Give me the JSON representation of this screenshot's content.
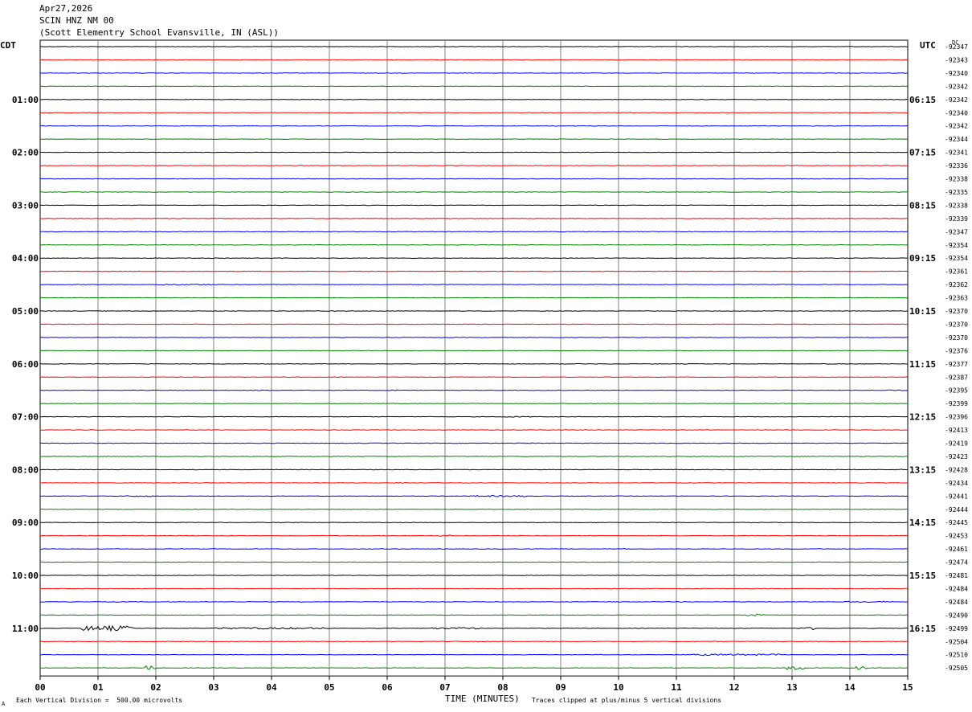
{
  "header": {
    "date": "Apr27,2026",
    "station": "SCIN HNZ NM 00",
    "location": "(Scott Elementry School Evansville, IN (ASL))"
  },
  "left_tz": "CDT",
  "right_tz": "UTC",
  "dc_label": "DC",
  "footer": {
    "scale_note": "Each Vertical Division =  500.00 microvolts",
    "x_title": "TIME (MINUTES)",
    "clip_note": "Traces clipped at plus/minus 5 vertical divisions",
    "corner_mark": "A"
  },
  "colors": {
    "trace_cycle": [
      "#000000",
      "#ff0000",
      "#0000ff",
      "#008000"
    ],
    "grid": "#808080"
  },
  "chart_data": {
    "type": "line",
    "title": "SCIN HNZ NM 00",
    "xlabel": "TIME (MINUTES)",
    "x_ticks": [
      "00",
      "01",
      "02",
      "03",
      "04",
      "05",
      "06",
      "07",
      "08",
      "09",
      "10",
      "11",
      "12",
      "13",
      "14",
      "15"
    ],
    "xlim": [
      0,
      15
    ],
    "minutes_per_line": 15,
    "left_time_labels": [
      "01:00",
      "02:00",
      "03:00",
      "04:00",
      "05:00",
      "06:00",
      "07:00",
      "08:00",
      "09:00",
      "10:00",
      "11:00"
    ],
    "right_time_labels": [
      "06:15",
      "07:15",
      "08:15",
      "09:15",
      "10:15",
      "11:15",
      "12:15",
      "13:15",
      "14:15",
      "15:15",
      "16:15"
    ],
    "dc_offsets": [
      "-92347",
      "-92343",
      "-92340",
      "-92342",
      "-92342",
      "-92340",
      "-92342",
      "-92344",
      "-92341",
      "-92336",
      "-92338",
      "-92335",
      "-92338",
      "-92339",
      "-92347",
      "-92354",
      "-92354",
      "-92361",
      "-92362",
      "-92363",
      "-92370",
      "-92370",
      "-92370",
      "-92376",
      "-92377",
      "-92387",
      "-92395",
      "-92399",
      "-92396",
      "-92413",
      "-92419",
      "-92423",
      "-92428",
      "-92434",
      "-92441",
      "-92444",
      "-92445",
      "-92453",
      "-92461",
      "-92474",
      "-92481",
      "-92484",
      "-92484",
      "-92490",
      "-92499",
      "-92504",
      "-92510",
      "-92505"
    ],
    "events": [
      {
        "trace": 18,
        "start": 2.0,
        "end": 3.0,
        "amp": 1.5
      },
      {
        "trace": 26,
        "start": 3.7,
        "end": 4.0,
        "amp": 1.2
      },
      {
        "trace": 26,
        "start": 5.9,
        "end": 6.2,
        "amp": 1.2
      },
      {
        "trace": 26,
        "start": 14.6,
        "end": 15.0,
        "amp": 1.2
      },
      {
        "trace": 28,
        "start": 2.3,
        "end": 2.6,
        "amp": 1.2
      },
      {
        "trace": 28,
        "start": 7.9,
        "end": 8.5,
        "amp": 1.2
      },
      {
        "trace": 30,
        "start": 8.1,
        "end": 8.5,
        "amp": 1.0
      },
      {
        "trace": 32,
        "start": 14.7,
        "end": 15.0,
        "amp": 1.2
      },
      {
        "trace": 33,
        "start": 6.1,
        "end": 6.4,
        "amp": 1.5
      },
      {
        "trace": 34,
        "start": 1.5,
        "end": 2.0,
        "amp": 1.5
      },
      {
        "trace": 34,
        "start": 7.5,
        "end": 8.4,
        "amp": 1.8
      },
      {
        "trace": 37,
        "start": 6.9,
        "end": 7.1,
        "amp": 3.0
      },
      {
        "trace": 38,
        "start": 9.9,
        "end": 10.2,
        "amp": 1.0
      },
      {
        "trace": 42,
        "start": 13.9,
        "end": 14.6,
        "amp": 1.5
      },
      {
        "trace": 43,
        "start": 12.2,
        "end": 12.5,
        "amp": 2.5
      },
      {
        "trace": 44,
        "start": 0.7,
        "end": 1.6,
        "amp": 6.0
      },
      {
        "trace": 44,
        "start": 3.0,
        "end": 5.0,
        "amp": 2.0
      },
      {
        "trace": 44,
        "start": 6.7,
        "end": 7.6,
        "amp": 2.0
      },
      {
        "trace": 44,
        "start": 13.1,
        "end": 13.4,
        "amp": 4.0
      },
      {
        "trace": 46,
        "start": 11.3,
        "end": 12.8,
        "amp": 2.0
      },
      {
        "trace": 47,
        "start": 1.8,
        "end": 2.0,
        "amp": 6.0
      },
      {
        "trace": 47,
        "start": 12.9,
        "end": 13.2,
        "amp": 5.0
      },
      {
        "trace": 47,
        "start": 14.1,
        "end": 14.3,
        "amp": 4.0
      }
    ]
  }
}
